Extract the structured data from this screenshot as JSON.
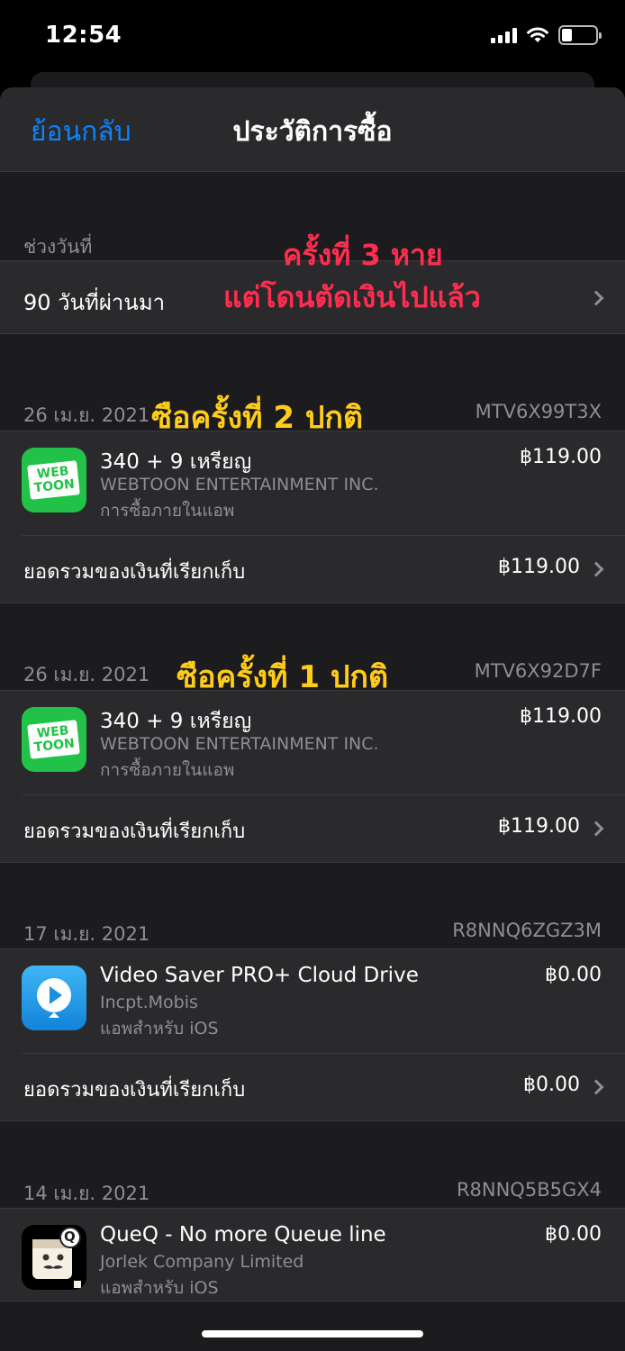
{
  "status_bar": {
    "time": "12:54",
    "battery_level": 0.3
  },
  "nav": {
    "back_label": "ย้อนกลับ",
    "title": "ประวัติการซื้อ"
  },
  "date_range": {
    "label": "ช่วงวันที่",
    "value": "90 วันที่ผ่านมา"
  },
  "annotations": {
    "red_line1": "ครั้งที่ 3 หาย",
    "red_line2": "แต่โดนตัดเงินไปแล้ว",
    "yellow_1": "ซือครั้งที่ 2 ปกติ",
    "yellow_2": "ซือครั้งที่ 1 ปกติ"
  },
  "total_label": "ยอดรวมของเงินที่เรียกเก็บ",
  "purchases": [
    {
      "date": "26 เม.ย. 2021",
      "order_id": "MTV6X99T3X",
      "title": "340 + 9 เหรียญ",
      "developer": "WEBTOON ENTERTAINMENT INC.",
      "kind": "การซื้อภายในแอพ",
      "price": "฿119.00",
      "total": "฿119.00",
      "icon": "webtoon-icon"
    },
    {
      "date": "26 เม.ย. 2021",
      "order_id": "MTV6X92D7F",
      "title": "340 + 9 เหรียญ",
      "developer": "WEBTOON ENTERTAINMENT INC.",
      "kind": "การซื้อภายในแอพ",
      "price": "฿119.00",
      "total": "฿119.00",
      "icon": "webtoon-icon"
    },
    {
      "date": "17 เม.ย. 2021",
      "order_id": "R8NNQ6ZGZ3M",
      "title": "Video Saver PRO+ Cloud Drive",
      "developer": "Incpt.Mobis",
      "kind": "แอพสำหรับ iOS",
      "price": "฿0.00",
      "total": "฿0.00",
      "icon": "video-saver-icon"
    },
    {
      "date": "14 เม.ย. 2021",
      "order_id": "R8NNQ5B5GX4",
      "title": "QueQ - No more Queue line",
      "developer": "Jorlek Company Limited",
      "kind": "แอพสำหรับ iOS",
      "price": "฿0.00",
      "icon": "queq-icon"
    }
  ],
  "icon_text": {
    "webtoon_top": "WEB",
    "webtoon_bottom": "TOON",
    "queq_badge": "Q"
  },
  "colors": {
    "accent": "#0a84ff",
    "annotation_red": "#ff2d4f",
    "annotation_yellow": "#ffcc1a",
    "background": "#1c1c1e"
  }
}
